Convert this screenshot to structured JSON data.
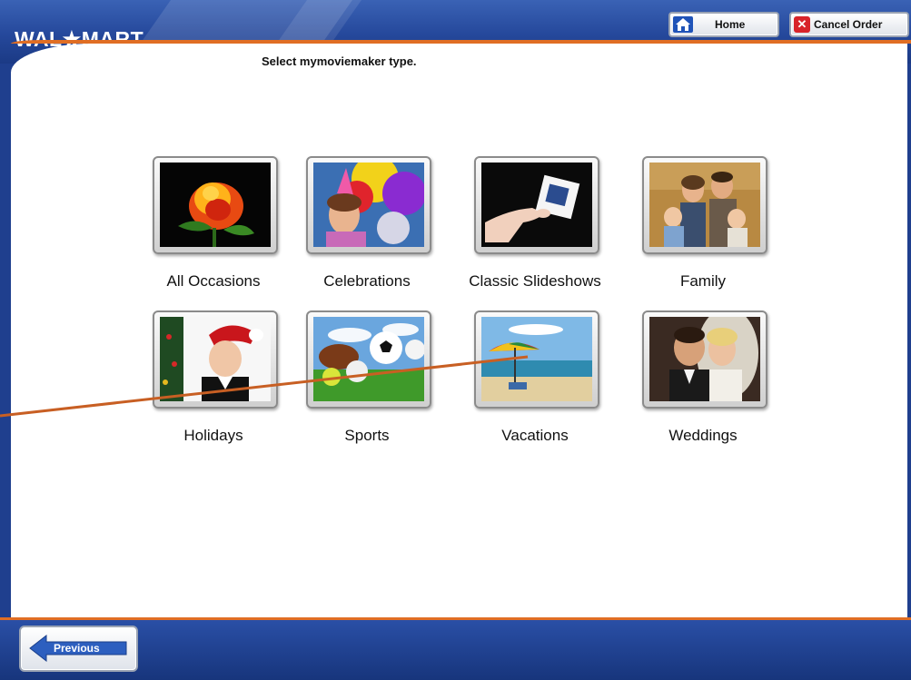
{
  "header": {
    "logo": "WAL★MART",
    "home_label": "Home",
    "cancel_label": "Cancel Order"
  },
  "main": {
    "title": "Select mymoviemaker type.",
    "types": [
      {
        "label": "All Occasions",
        "image": "rose"
      },
      {
        "label": "Celebrations",
        "image": "balloons-girl"
      },
      {
        "label": "Classic Slideshows",
        "image": "slide-in-hand"
      },
      {
        "label": "Family",
        "image": "family-portrait"
      },
      {
        "label": "Holidays",
        "image": "child-holiday"
      },
      {
        "label": "Sports",
        "image": "sports-balls"
      },
      {
        "label": "Vacations",
        "image": "beach-umbrella"
      },
      {
        "label": "Weddings",
        "image": "wedding-couple"
      }
    ]
  },
  "footer": {
    "previous_label": "Previous"
  },
  "colors": {
    "frame_blue": "#1f3f8e",
    "accent_orange": "#e06e24"
  }
}
